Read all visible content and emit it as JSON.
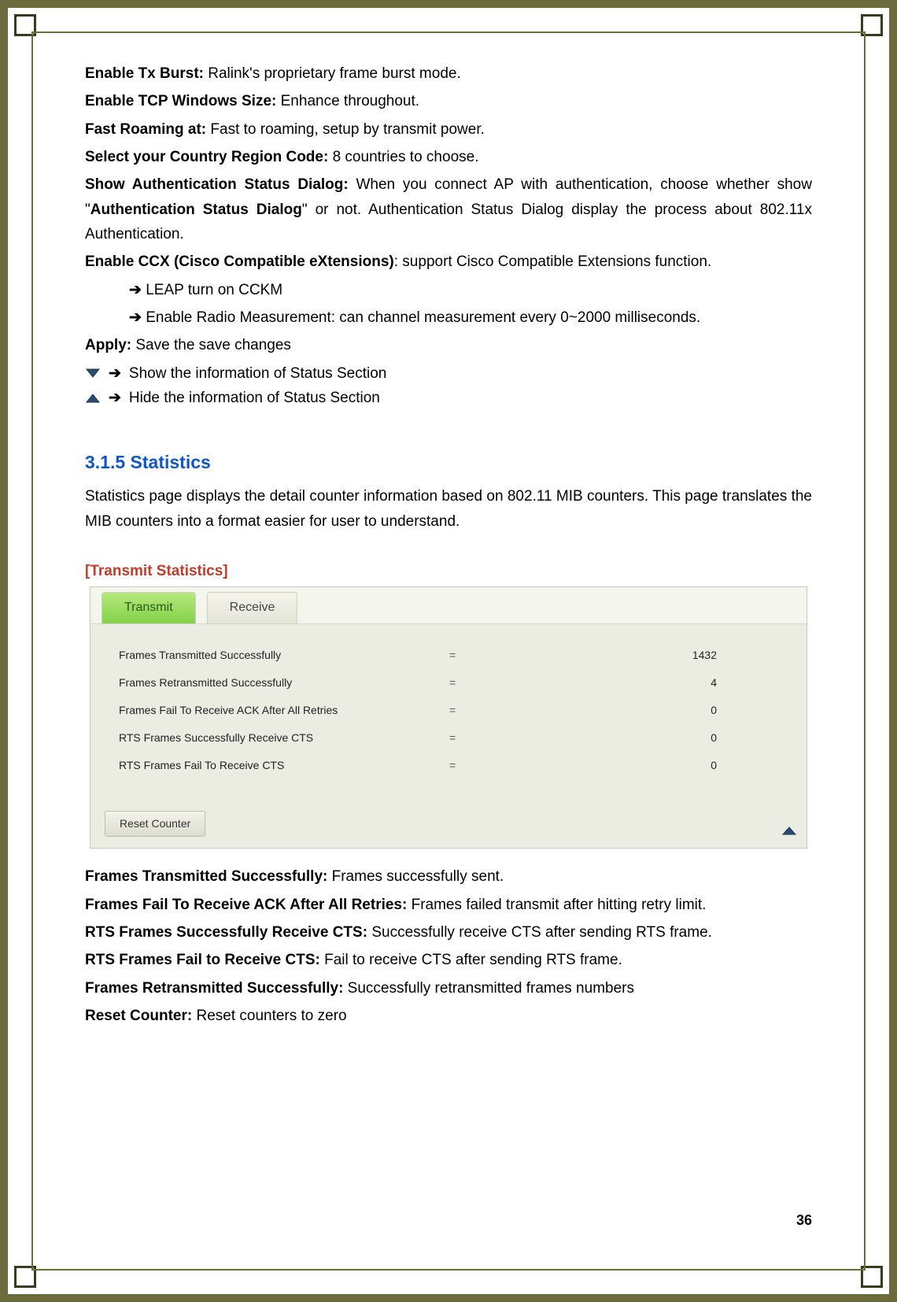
{
  "defs": {
    "txburst_label": "Enable Tx Burst:",
    "txburst_text": " Ralink's proprietary frame burst mode.",
    "tcpwin_label": "Enable TCP Windows Size:",
    "tcpwin_text": " Enhance throughout.",
    "fastroam_label": "Fast Roaming at:",
    "fastroam_text": " Fast to roaming, setup by transmit power.",
    "country_label": "Select your Country Region Code:",
    "country_text": " 8 countries to choose.",
    "auth_label": "Show Authentication Status Dialog:",
    "auth_text_1": " When you connect AP with authentication, choose whether show \"",
    "auth_bold": "Authentication Status Dialog",
    "auth_text_2": "\" or not. Authentication Status Dialog display the process about 802.11x Authentication.",
    "ccx_label": "Enable CCX (Cisco Compatible eXtensions)",
    "ccx_text": ": support Cisco Compatible Extensions function.",
    "bullet_leap": "LEAP turn on CCKM",
    "bullet_radio": "Enable Radio Measurement: can channel measurement every 0~2000 milliseconds.",
    "apply_label": "Apply:",
    "apply_text": " Save the save changes",
    "show_line": "Show the information of Status Section",
    "hide_line": "Hide the information of Status Section"
  },
  "section": {
    "heading": "3.1.5   Statistics",
    "intro": "Statistics page displays the detail counter information based on 802.11 MIB counters. This page translates the MIB counters into a format easier for user to understand.",
    "subhead": "[Transmit Statistics]"
  },
  "panel": {
    "tab_transmit": "Transmit",
    "tab_receive": "Receive",
    "rows": [
      {
        "label": "Frames Transmitted Successfully",
        "eq": "=",
        "val": "1432"
      },
      {
        "label": "Frames Retransmitted Successfully",
        "eq": "=",
        "val": "4"
      },
      {
        "label": "Frames Fail To Receive ACK After All Retries",
        "eq": "=",
        "val": "0"
      },
      {
        "label": "RTS Frames Successfully Receive CTS",
        "eq": "=",
        "val": "0"
      },
      {
        "label": "RTS Frames Fail To Receive CTS",
        "eq": "=",
        "val": "0"
      }
    ],
    "reset_label": "Reset Counter"
  },
  "footer_defs": {
    "fts_label": "Frames Transmitted Successfully:",
    "fts_text": " Frames successfully sent.",
    "ffrack_label": "Frames Fail To Receive ACK After All Retries:",
    "ffrack_text": " Frames failed transmit after hitting retry limit.",
    "rtscts_label": "RTS Frames Successfully Receive CTS:",
    "rtscts_text": " Successfully receive CTS after sending RTS frame.",
    "rtsfail_label": "RTS Frames Fail to Receive CTS:",
    "rtsfail_text": " Fail to receive CTS after sending RTS frame.",
    "fretrans_label": "Frames Retransmitted Successfully:",
    "fretrans_text": " Successfully retransmitted frames numbers",
    "reset_label": "Reset Counter:",
    "reset_text": " Reset counters to zero"
  },
  "page_number": "36",
  "arrow_glyph": "➔"
}
